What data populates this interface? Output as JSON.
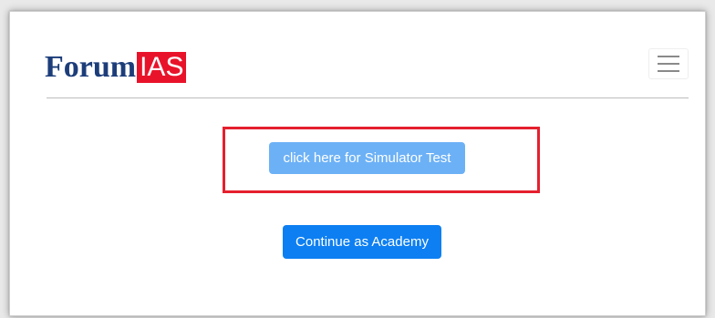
{
  "header": {
    "logo": {
      "forum_text": "Forum",
      "ias_text": "IAS",
      "forum_color": "#1c3d7a",
      "ias_bg_color": "#e8132a"
    },
    "menu_toggle_icon": "hamburger-menu-icon"
  },
  "main": {
    "simulator_button_label": "click here for Simulator Test",
    "academy_button_label": "Continue as Academy",
    "highlight_color": "#e5202e",
    "primary_color": "#0d7ff2",
    "disabled_color": "#6cb1f6"
  }
}
